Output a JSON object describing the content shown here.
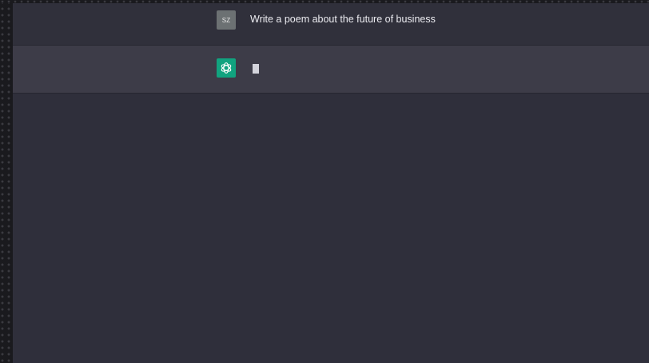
{
  "conversation": {
    "user_message": {
      "avatar_initials": "SZ",
      "text": "Write a poem about the future of business",
      "avatar_color": "#6c7173"
    },
    "assistant_message": {
      "avatar_icon": "openai-logo-icon",
      "avatar_color": "#11a37f",
      "text": "",
      "status": "generating"
    }
  },
  "colors": {
    "background": "#2f2f3b",
    "assistant_row": "#3d3c48",
    "text": "#ececf1"
  }
}
